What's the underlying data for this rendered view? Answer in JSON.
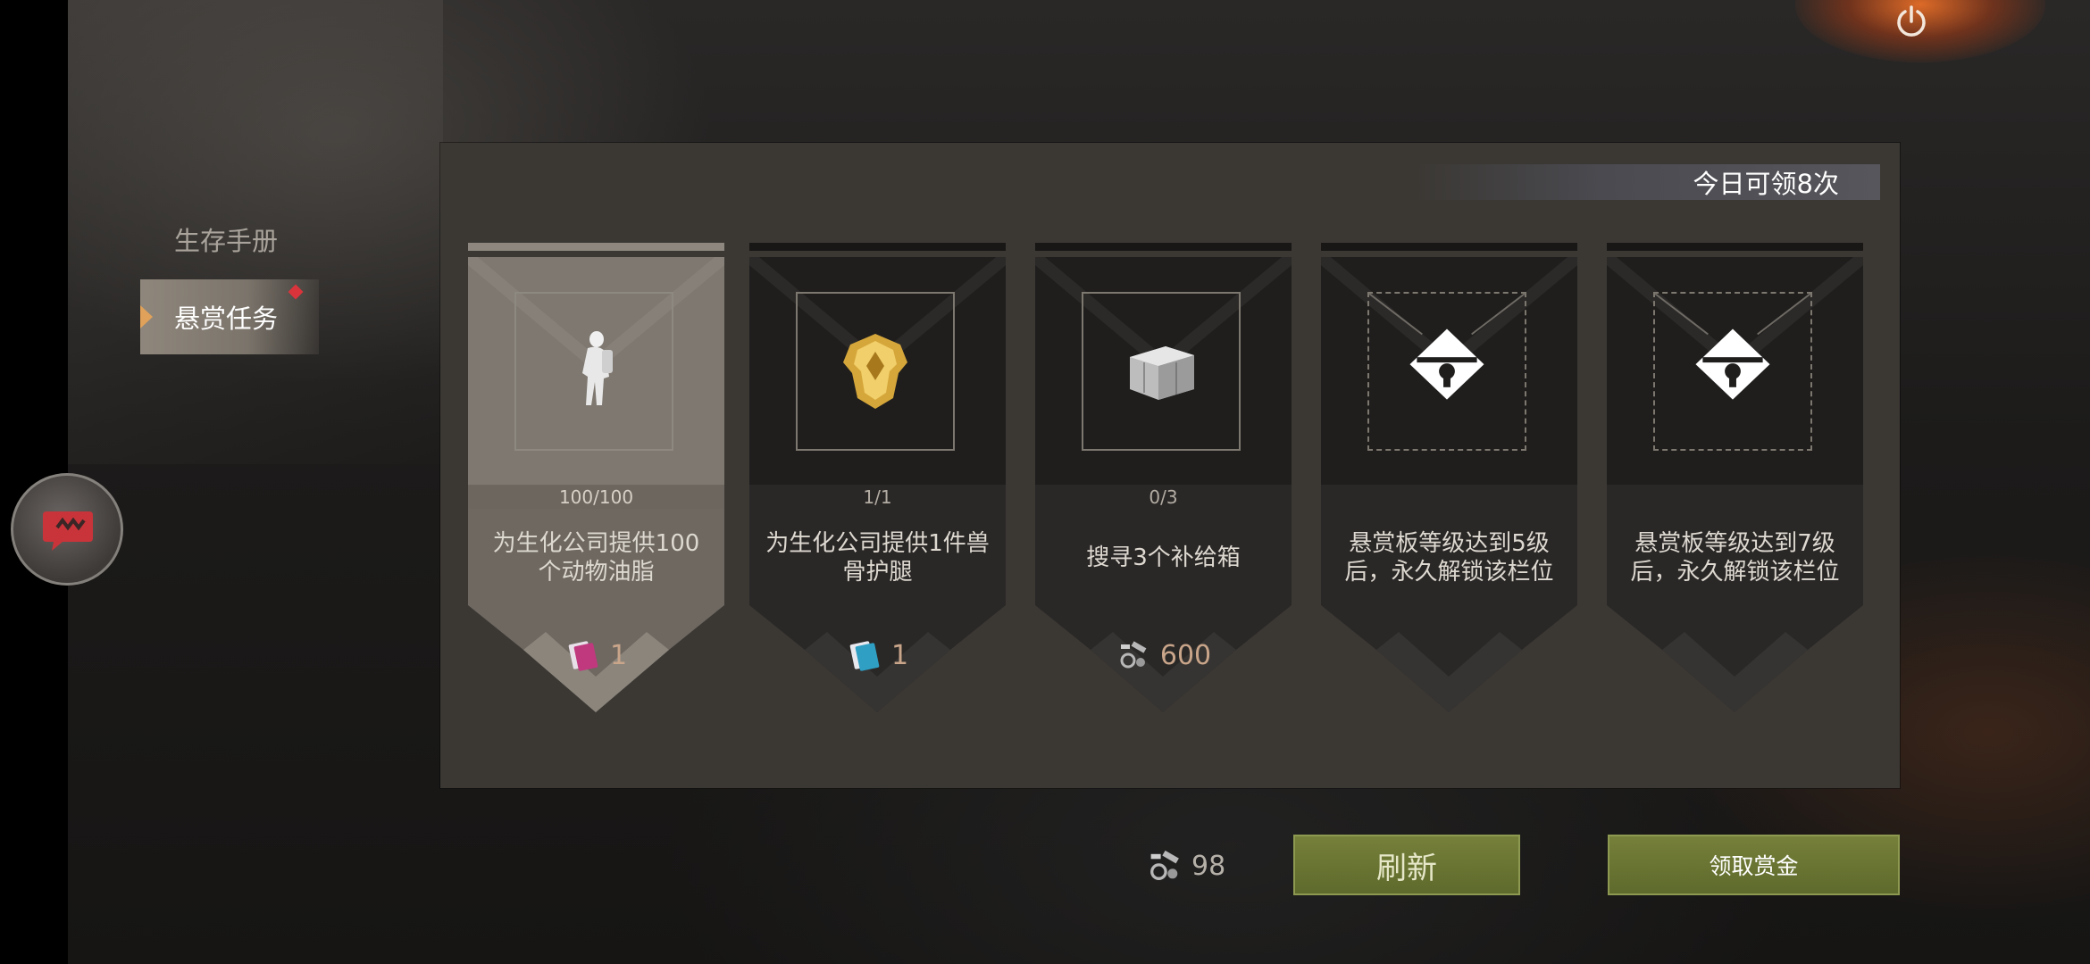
{
  "nav": {
    "items": [
      {
        "label": "生存手册",
        "active": false
      },
      {
        "label": "悬赏任务",
        "active": true,
        "has_notification": true
      }
    ]
  },
  "panel": {
    "daily_limit": "今日可领8次",
    "cards": [
      {
        "state": "active",
        "icon": "soldier-figure-icon",
        "progress": "100/100",
        "description": "为生化公司提供100个动物油脂",
        "reward_icon": "magenta-card-icon",
        "reward_value": "1"
      },
      {
        "state": "normal",
        "icon": "golden-armor-icon",
        "progress": "1/1",
        "description": "为生化公司提供1件兽骨护腿",
        "reward_icon": "blue-card-icon",
        "reward_value": "1"
      },
      {
        "state": "normal",
        "icon": "supply-crate-icon",
        "progress": "0/3",
        "description": "搜寻3个补给箱",
        "reward_icon": "parts-icon",
        "reward_value": "600"
      },
      {
        "state": "locked",
        "icon": "lock-icon",
        "description": "悬赏板等级达到5级后，永久解锁该栏位"
      },
      {
        "state": "locked",
        "icon": "lock-icon",
        "description": "悬赏板等级达到7级后，永久解锁该栏位"
      }
    ]
  },
  "footer": {
    "currency_icon": "parts-icon",
    "currency_value": "98",
    "refresh_label": "刷新",
    "claim_label": "领取赏金"
  },
  "colors": {
    "accent_button": "#6a7532",
    "reward_text": "#d9a271",
    "notification": "#d9343c"
  }
}
